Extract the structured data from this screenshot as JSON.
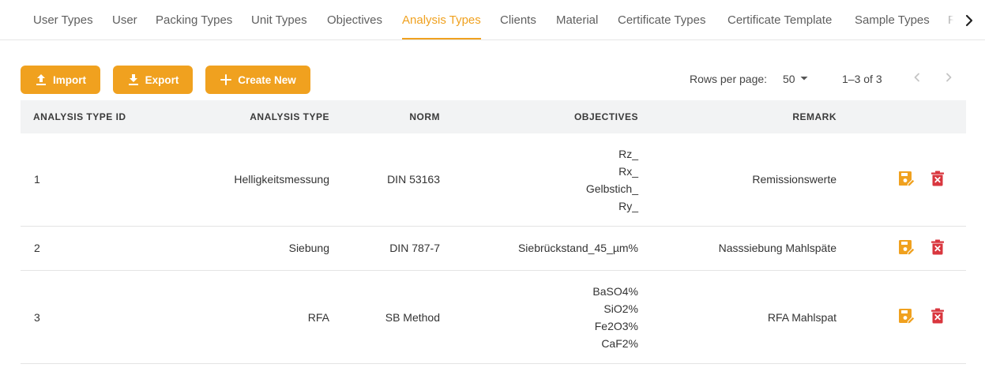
{
  "tabs": [
    {
      "label": "User Types",
      "active": false
    },
    {
      "label": "User",
      "active": false
    },
    {
      "label": "Packing Types",
      "active": false
    },
    {
      "label": "Unit Types",
      "active": false
    },
    {
      "label": "Objectives",
      "active": false
    },
    {
      "label": "Analysis Types",
      "active": true
    },
    {
      "label": "Clients",
      "active": false
    },
    {
      "label": "Material",
      "active": false
    },
    {
      "label": "Certificate Types",
      "active": false
    },
    {
      "label": "Certificate Template",
      "active": false
    },
    {
      "label": "Sample Types",
      "active": false
    },
    {
      "label": "R",
      "active": false
    }
  ],
  "toolbar": {
    "import_label": "Import",
    "export_label": "Export",
    "create_label": "Create New"
  },
  "pagination": {
    "rows_per_page_label": "Rows per page:",
    "rows_per_page_value": "50",
    "range_text": "1–3 of 3"
  },
  "table": {
    "columns": [
      "ANALYSIS TYPE ID",
      "ANALYSIS TYPE",
      "NORM",
      "OBJECTIVES",
      "REMARK"
    ],
    "rows": [
      {
        "id": "1",
        "type": "Helligkeitsmessung",
        "norm": "DIN 53163",
        "objectives": [
          "Rz_",
          "Rx_",
          "Gelbstich_",
          "Ry_"
        ],
        "remark": "Remissionswerte"
      },
      {
        "id": "2",
        "type": "Siebung",
        "norm": "DIN 787-7",
        "objectives": [
          "Siebrückstand_45_µm%"
        ],
        "remark": "Nasssiebung Mahlspäte"
      },
      {
        "id": "3",
        "type": "RFA",
        "norm": "SB Method",
        "objectives": [
          "BaSO4%",
          "SiO2%",
          "Fe2O3%",
          "CaF2%"
        ],
        "remark": "RFA Mahlspat"
      }
    ]
  },
  "colors": {
    "accent": "#f0a11f",
    "delete": "#d9363e",
    "header_bg": "#f2f3f4"
  },
  "icons": {
    "import": "upload-icon",
    "export": "download-icon",
    "create": "plus-icon",
    "edit": "save-edit-icon",
    "delete": "delete-icon",
    "tabs_next": "chevron-right-icon"
  }
}
